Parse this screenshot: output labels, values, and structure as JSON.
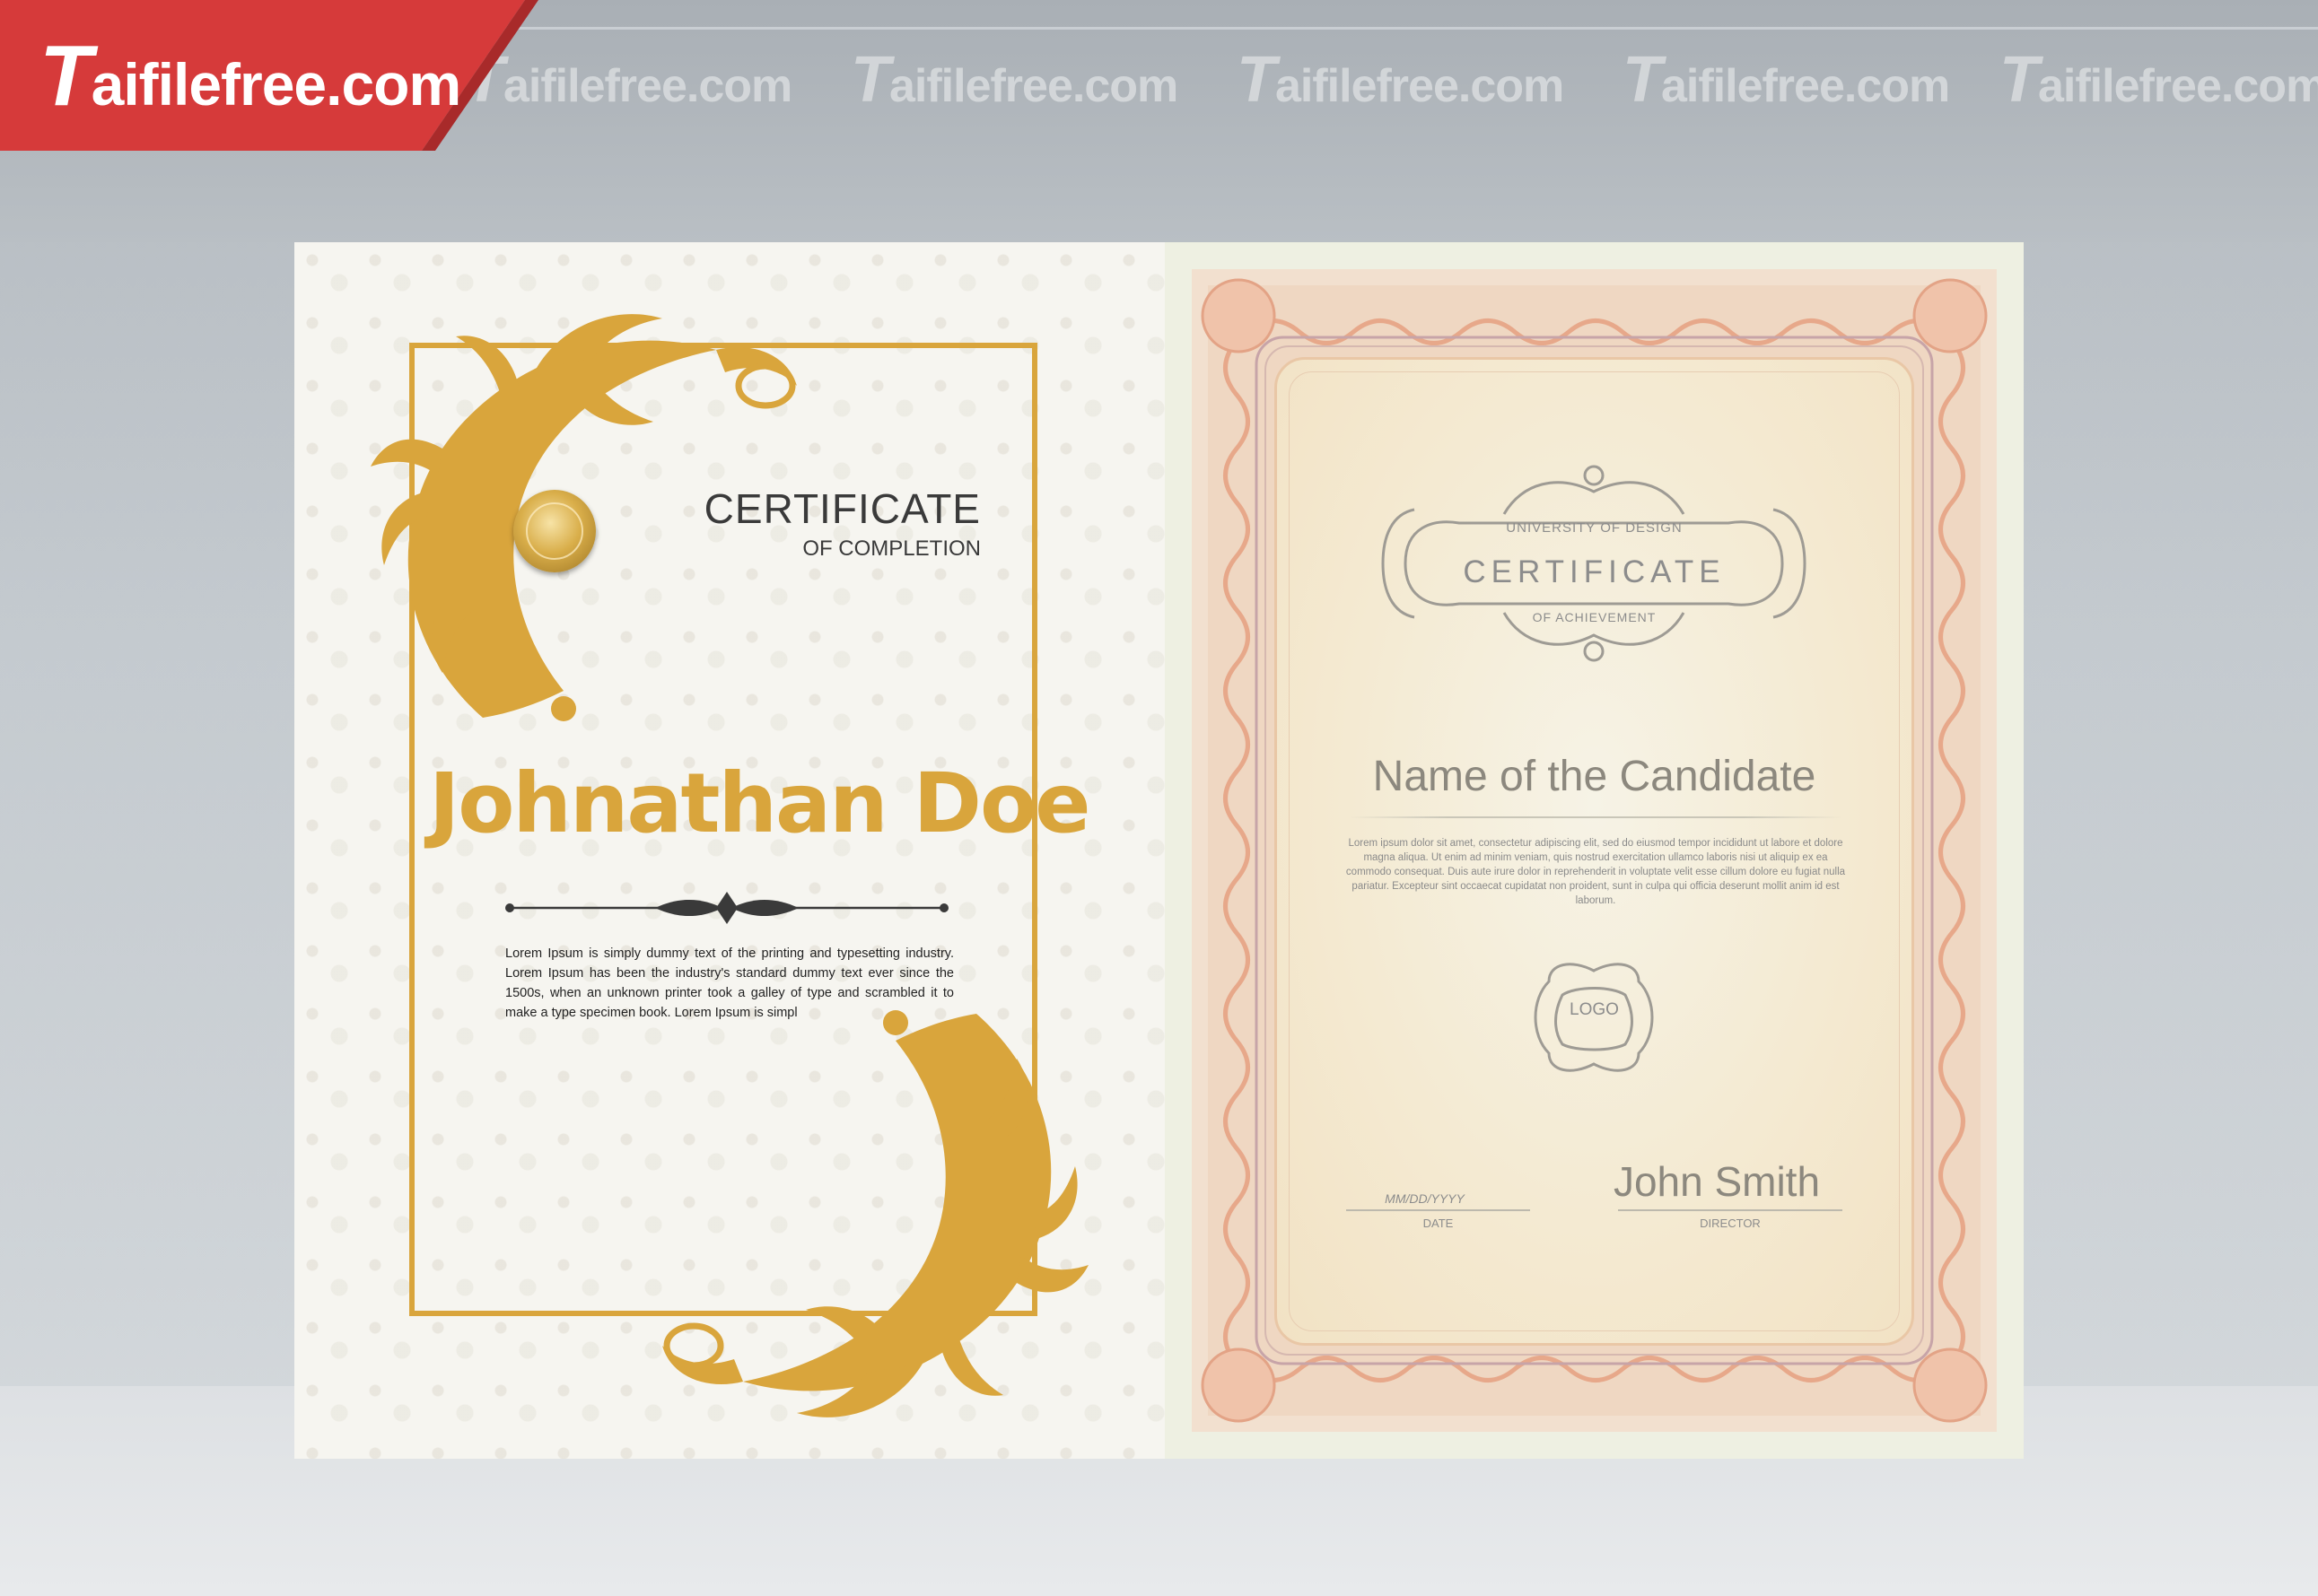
{
  "watermark": {
    "text": "aifilefree.com",
    "initial": "T",
    "badge_color": "#d63a3a"
  },
  "left_certificate": {
    "title": "CERTIFICATE",
    "subtitle": "OF COMPLETION",
    "recipient": "Johnathan Doe",
    "body": "Lorem Ipsum is simply dummy text of the printing and typesetting industry. Lorem Ipsum has been the industry's standard dummy text ever since the 1500s, when an unknown printer took a galley of type and scrambled it to make a type specimen book. Lorem Ipsum is simpl",
    "accent_color": "#d9a53c"
  },
  "right_certificate": {
    "institution": "UNIVERSITY OF DESIGN",
    "title": "CERTIFICATE",
    "subtitle": "OF ACHIEVEMENT",
    "recipient": "Name of the Candidate",
    "body": "Lorem ipsum dolor sit amet, consectetur adipiscing elit, sed do eiusmod tempor incididunt ut labore et dolore magna aliqua. Ut enim ad minim veniam, quis nostrud exercitation ullamco laboris nisi ut aliquip ex ea commodo consequat. Duis aute irure dolor in reprehenderit in voluptate velit esse cillum dolore eu fugiat nulla pariatur. Excepteur sint occaecat cupidatat non proident, sunt in culpa qui officia deserunt mollit anim id est laborum.",
    "logo": "LOGO",
    "date_value": "MM/DD/YYYY",
    "date_label": "DATE",
    "signature": "John Smith",
    "signature_label": "DIRECTOR"
  }
}
